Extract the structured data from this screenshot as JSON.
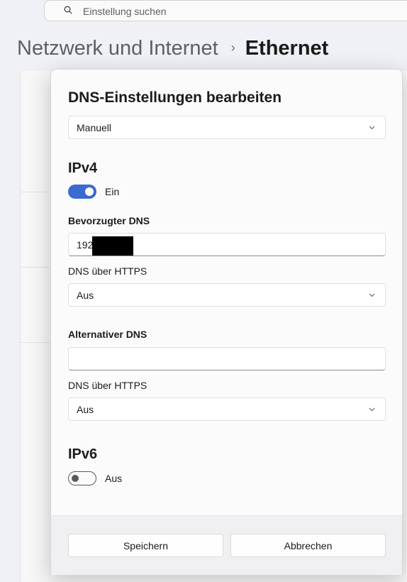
{
  "search": {
    "placeholder": "Einstellung suchen",
    "icon": "search-icon"
  },
  "breadcrumb": {
    "parent": "Netzwerk und Internet",
    "separator": "›",
    "current": "Ethernet"
  },
  "dialog": {
    "title": "DNS-Einstellungen bearbeiten",
    "mode_select": {
      "value": "Manuell"
    },
    "ipv4": {
      "heading": "IPv4",
      "toggle_state": "Ein",
      "toggle_on": true,
      "preferred_dns": {
        "label": "Bevorzugter DNS",
        "value": "192"
      },
      "preferred_https": {
        "label": "DNS über HTTPS",
        "value": "Aus"
      },
      "alternate_dns": {
        "label": "Alternativer DNS",
        "value": ""
      },
      "alternate_https": {
        "label": "DNS über HTTPS",
        "value": "Aus"
      }
    },
    "ipv6": {
      "heading": "IPv6",
      "toggle_state": "Aus",
      "toggle_on": false
    },
    "buttons": {
      "save": "Speichern",
      "cancel": "Abbrechen"
    }
  },
  "colors": {
    "accent": "#3a6bd0",
    "dialog_bg": "#fbfbfb",
    "page_bg": "#f0f1f6",
    "footer_bg": "#f0f0f3"
  }
}
